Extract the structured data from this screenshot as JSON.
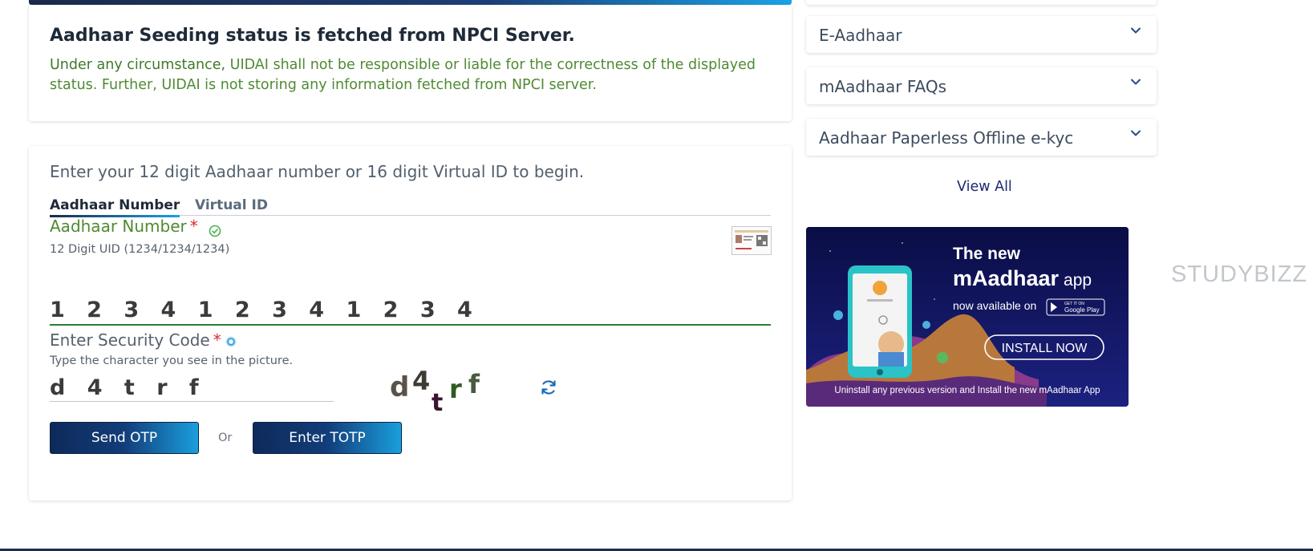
{
  "notice": {
    "title": "Aadhaar Seeding status is fetched from NPCI Server.",
    "text_part1": "Under any circumstance, ",
    "text_part2": "UIDAI shall not be responsible or liable for the correctness of the displayed status. Further, UIDAI is not storing any information fetched from NPCI server."
  },
  "form": {
    "intro": "Enter your 12 digit Aadhaar number or 16 digit Virtual ID to begin.",
    "tabs": [
      {
        "label": "Aadhaar Number",
        "active": true
      },
      {
        "label": "Virtual ID",
        "active": false
      }
    ],
    "aadhaar_label": "Aadhaar Number",
    "required_mark": "*",
    "aadhaar_hint": "12 Digit UID (1234/1234/1234)",
    "aadhaar_value": "1 2 3 4 1 2 3 4 1 2 3 4",
    "security_label": "Enter Security Code",
    "security_hint": "Type the character you see in the picture.",
    "security_value": "d 4 t r f",
    "captcha_chars": [
      "d",
      "4",
      "t",
      "r",
      "f"
    ],
    "send_otp": "Send OTP",
    "or": "Or",
    "enter_totp": "Enter TOTP"
  },
  "sidebar": {
    "items": [
      {
        "label": "E-Aadhaar"
      },
      {
        "label": "mAadhaar FAQs"
      },
      {
        "label": "Aadhaar Paperless Offline e-kyc"
      }
    ],
    "view_all": "View All"
  },
  "banner": {
    "line1": "The new",
    "line2_bold": "mAadhaar",
    "line2_rest": "app",
    "line3": "now available on",
    "store_small": "GET IT ON",
    "store_big": "Google Play",
    "install": "INSTALL NOW",
    "footer": "Uninstall any previous version and Install the new mAadhaar App"
  },
  "watermark": "STUDYBIZZ",
  "colors": {
    "accent_green": "#4f8a32",
    "button_dark": "#0d2a5a",
    "button_light": "#1a9fdc",
    "required_red": "#d32f2f"
  }
}
